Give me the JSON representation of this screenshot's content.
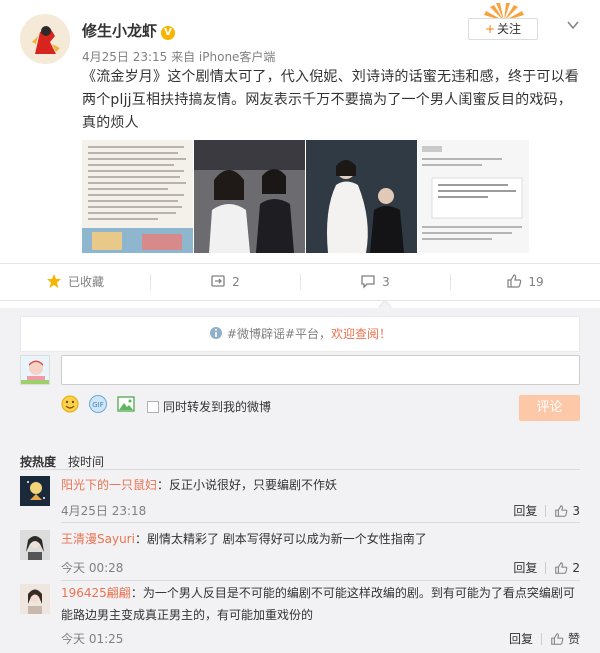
{
  "post": {
    "username": "修生小龙虾",
    "verified_badge": "V",
    "meta": "4月25日 23:15 来自 iPhone客户端",
    "follow_label": "关注",
    "text": "《流金岁月》这个剧情太可了，代入倪妮、刘诗诗的话蜜无违和感，终于可以看两个pljj互相扶持搞友情。网友表示千万不要搞为了一个男人闺蜜反目的戏码，真的烦人",
    "images": [
      "text-screenshot",
      "event-photo",
      "stage-photo",
      "social-post-screenshot"
    ]
  },
  "actions": {
    "favorite": "已收藏",
    "repost": "2",
    "comment": "3",
    "like": "19"
  },
  "comment_box": {
    "notice_prefix": "#微博辟谣#平台，",
    "notice_link": "欢迎查阅！",
    "forward_label": "同时转发到我的微博",
    "submit_label": "评论"
  },
  "sort": {
    "hot": "按热度",
    "time": "按时间"
  },
  "comments": [
    {
      "name": "阳光下的一只鼠妇",
      "text": "：反正小说很好，只要编剧不作妖",
      "time": "4月25日 23:18",
      "reply": "回复",
      "likes": "3"
    },
    {
      "name": "王清漫Sayuri",
      "text": "：剧情太精彩了 剧本写得好可以成为新一个女性指南了",
      "time": "今天 00:28",
      "reply": "回复",
      "likes": "2"
    },
    {
      "name": "196425翩翩",
      "text": "：为一个男人反目是不可能的编剧不可能这样改编的剧。到有可能为了看点突编剧可能路边男主变成真正男主的，有可能加重戏份的",
      "time": "今天 01:25",
      "reply": "回复",
      "likes": "赞"
    }
  ],
  "colors": {
    "accent": "#eb7350",
    "follow_plus": "#f77c0d",
    "submit_bg": "#fcc8a8",
    "comment_bg": "#f2f2f5",
    "badge": "#f7b500"
  }
}
